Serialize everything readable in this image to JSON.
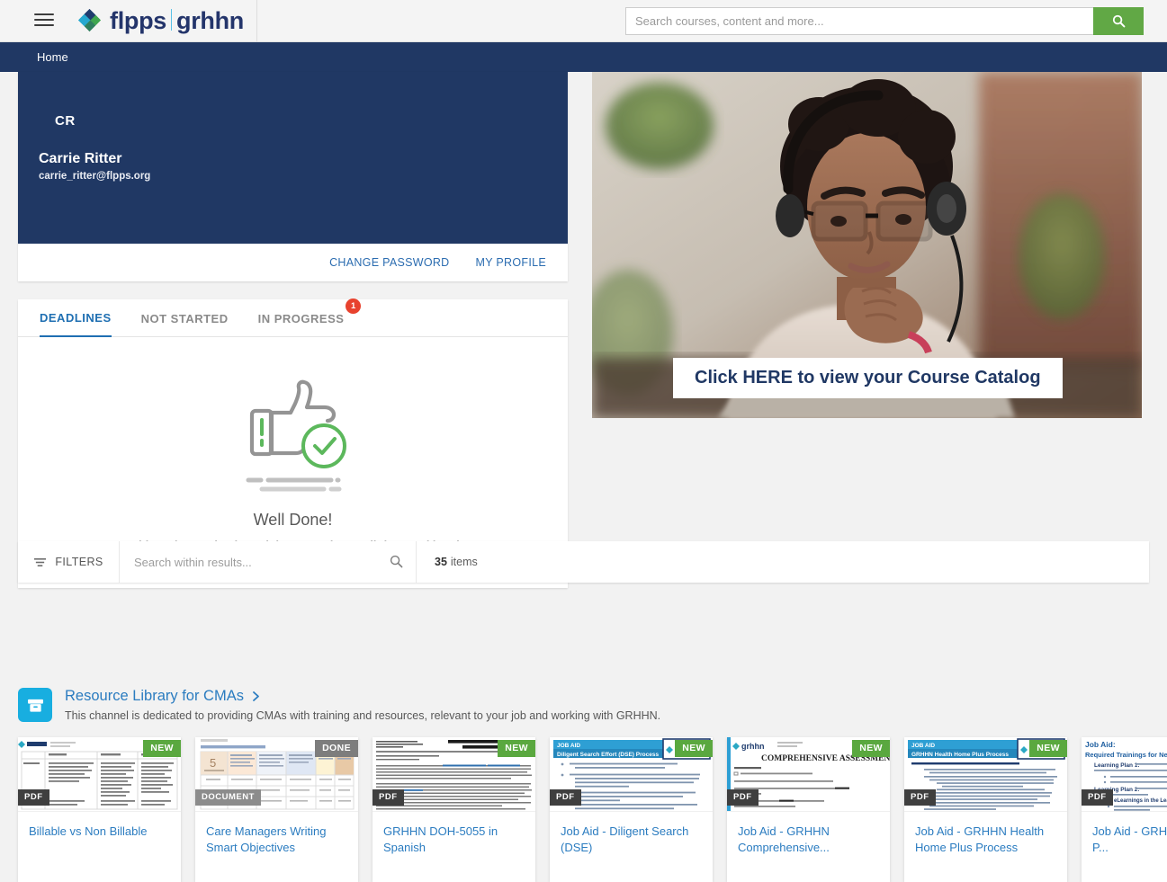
{
  "header": {
    "menu_icon": "hamburger-icon",
    "logo": {
      "primary": "flpps",
      "secondary": "grhhn"
    },
    "search": {
      "placeholder": "Search courses, content and more...",
      "value": "",
      "button_icon": "search-icon",
      "button_color": "#61a845"
    }
  },
  "breadcrumb": {
    "items": [
      "Home"
    ]
  },
  "profile": {
    "initials": "CR",
    "name": "Carrie Ritter",
    "email": "carrie_ritter@flpps.org",
    "hero_color": "#203864",
    "actions": [
      {
        "label": "CHANGE PASSWORD",
        "name": "change-password-link"
      },
      {
        "label": "MY PROFILE",
        "name": "my-profile-link"
      }
    ]
  },
  "tabs": [
    {
      "label": "DEADLINES",
      "active": true,
      "badge": null
    },
    {
      "label": "NOT STARTED",
      "active": false,
      "badge": null
    },
    {
      "label": "IN PROGRESS",
      "active": false,
      "badge": "1"
    }
  ],
  "empty_state": {
    "title": "Well Done!",
    "subtitle": "Nothing's happening here right now. Take a well-deserved break.",
    "icon": "thumbs-up-check-icon",
    "accent_color": "#5cb85c"
  },
  "banner": {
    "cta_text": "Click HERE to view your Course Catalog",
    "cta_color": "#203864",
    "alt": "woman-with-headphones-studying-photo"
  },
  "filterbar": {
    "filters_label": "FILTERS",
    "filters_icon": "filter-icon",
    "search_placeholder": "Search within results...",
    "search_value": "",
    "search_icon": "search-icon",
    "items_count": "35",
    "items_label": "items"
  },
  "channel": {
    "icon": "archive-box-icon",
    "icon_color": "#18aee0",
    "title": "Resource Library for CMAs",
    "chevron": "chevron-right-icon",
    "description": "This channel is dedicated to providing CMAs with training and resources, relevant to your job and working with GRHHN."
  },
  "cards": [
    {
      "title": "Billable vs Non Billable",
      "status": "NEW",
      "status_kind": "new",
      "type": "PDF",
      "type_kind": "dark",
      "thumb": "grhhn-table-document"
    },
    {
      "title": "Care Managers Writing Smart Objectives",
      "status": "DONE",
      "status_kind": "done",
      "type": "DOCUMENT",
      "type_kind": "gray",
      "thumb": "smart-objectives-grid"
    },
    {
      "title": "GRHHN DOH-5055 in Spanish",
      "status": "NEW",
      "status_kind": "new",
      "type": "PDF",
      "type_kind": "dark",
      "thumb": "spanish-consent-form"
    },
    {
      "title": "Job Aid - Diligent Search (DSE)",
      "status": "NEW",
      "status_kind": "new",
      "type": "PDF",
      "type_kind": "dark",
      "thumb": "job-aid-diligent-search"
    },
    {
      "title": "Job Aid - GRHHN Comprehensive...",
      "status": "NEW",
      "status_kind": "new",
      "type": "PDF",
      "type_kind": "dark",
      "thumb": "comprehensive-assessment"
    },
    {
      "title": "Job Aid - GRHHN Health Home Plus Process",
      "status": "NEW",
      "status_kind": "new",
      "type": "PDF",
      "type_kind": "dark",
      "thumb": "health-home-plus-process"
    },
    {
      "title": "Job Aid - GRHHN Learning P...",
      "status": "",
      "status_kind": "none",
      "type": "PDF",
      "type_kind": "dark",
      "thumb": "learning-plan-job-aid"
    }
  ]
}
